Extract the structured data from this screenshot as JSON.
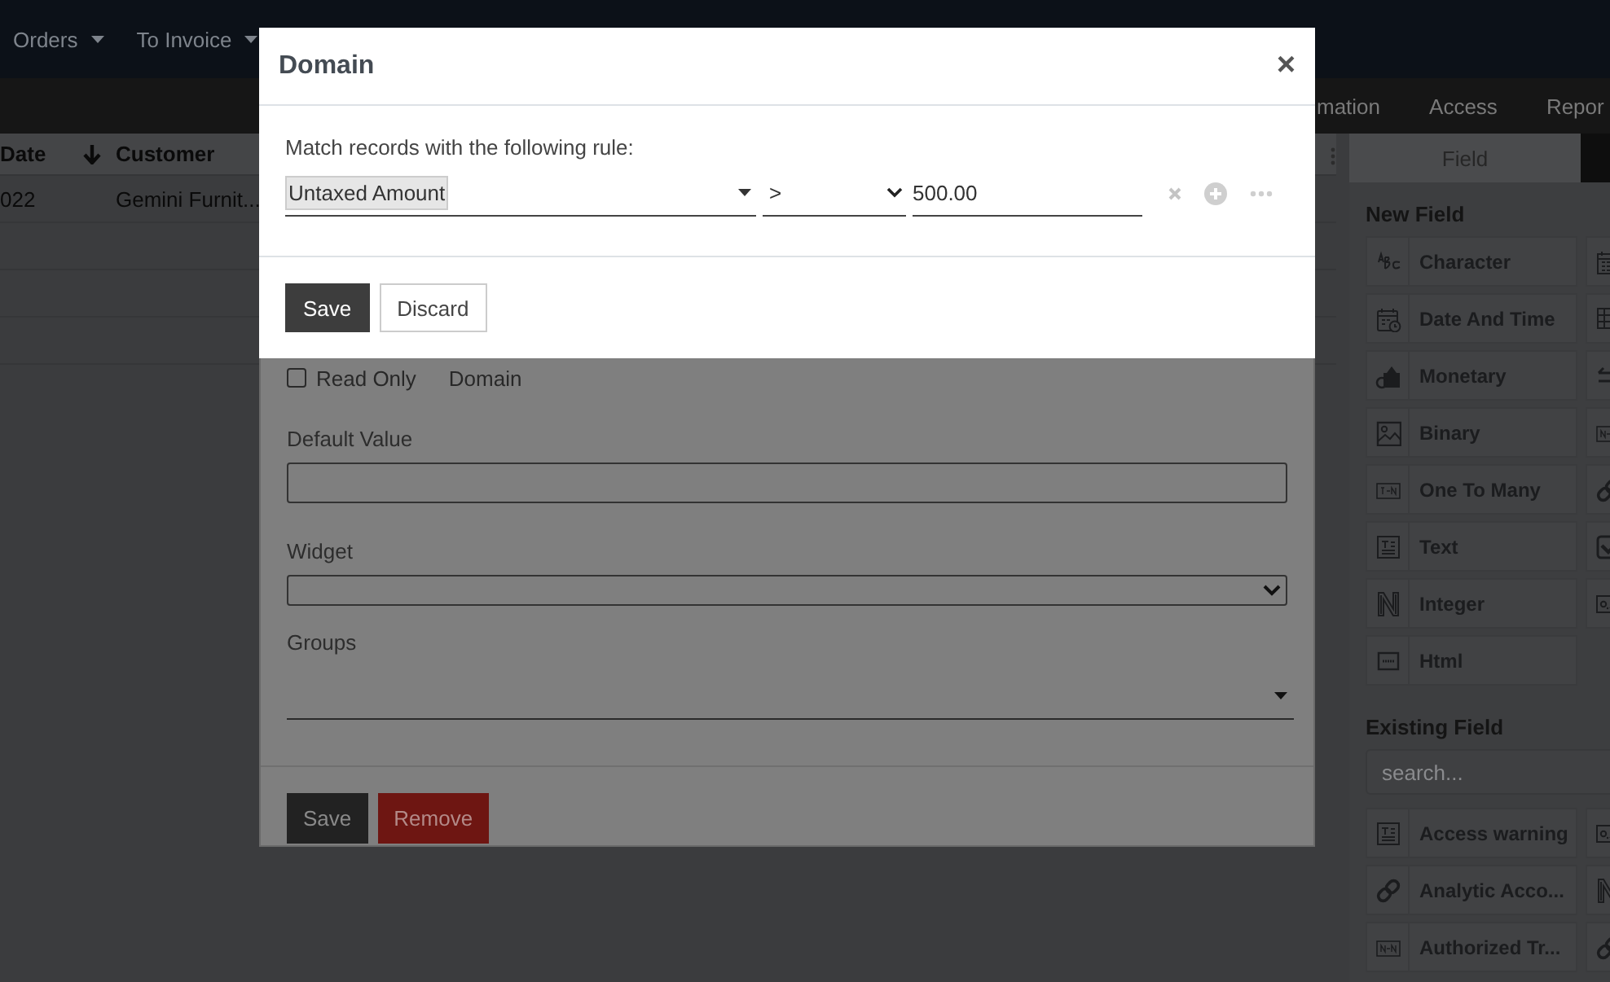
{
  "navbar": {
    "menus": [
      {
        "label": "Orders"
      },
      {
        "label": "To Invoice"
      }
    ]
  },
  "subnav": {
    "tabs": [
      {
        "label": "mation"
      },
      {
        "label": "Access"
      },
      {
        "label": "Repor"
      }
    ]
  },
  "list": {
    "columns": [
      {
        "label": "Date",
        "sorted": true
      },
      {
        "label": "Customer",
        "sorted": false
      }
    ],
    "rows": [
      [
        "022",
        "Gemini Furnit..."
      ]
    ]
  },
  "sidebar": {
    "tab": "Field",
    "new_field_title": "New Field",
    "new_fields": [
      {
        "label": "Character",
        "kind": "abc"
      },
      {
        "kind": "calendar"
      },
      {
        "label": "Date And Time",
        "kind": "datetime"
      },
      {
        "kind": "selection"
      },
      {
        "label": "Monetary",
        "kind": "monetary"
      },
      {
        "kind": "arrows"
      },
      {
        "label": "Binary",
        "kind": "image"
      },
      {
        "kind": "many2many"
      },
      {
        "label": "One To Many",
        "kind": "one2many"
      },
      {
        "kind": "link"
      },
      {
        "label": "Text",
        "kind": "text"
      },
      {
        "kind": "checkbox"
      },
      {
        "label": "Integer",
        "kind": "integer"
      },
      {
        "kind": "float"
      },
      {
        "label": "Html",
        "kind": "html"
      }
    ],
    "existing_field_title": "Existing Field",
    "search": {
      "placeholder": "search..."
    },
    "existing_fields": [
      {
        "label": "Access warning",
        "kind": "text"
      },
      {
        "kind": "float"
      },
      {
        "label": "Analytic Acco...",
        "kind": "link"
      },
      {
        "kind": "integer"
      },
      {
        "label": "Authorized Tr...",
        "kind": "many2many"
      },
      {
        "kind": "link"
      }
    ]
  },
  "field_dialog": {
    "read_only": {
      "label": "Read Only",
      "checked": false
    },
    "domain_label": "Domain",
    "default_value": {
      "label": "Default Value"
    },
    "widget": {
      "label": "Widget"
    },
    "groups": {
      "label": "Groups"
    },
    "buttons": [
      {
        "label": "Save",
        "kind": "primary"
      },
      {
        "label": "Remove",
        "kind": "danger"
      }
    ]
  },
  "domain_dialog": {
    "title": "Domain",
    "close": "×",
    "intro": "Match records with the following rule:",
    "rule": {
      "field": "Untaxed Amount",
      "operator": ">",
      "value": "500.00"
    },
    "buttons": [
      {
        "label": "Save",
        "kind": "primary"
      },
      {
        "label": "Discard",
        "kind": "secondary"
      }
    ]
  }
}
